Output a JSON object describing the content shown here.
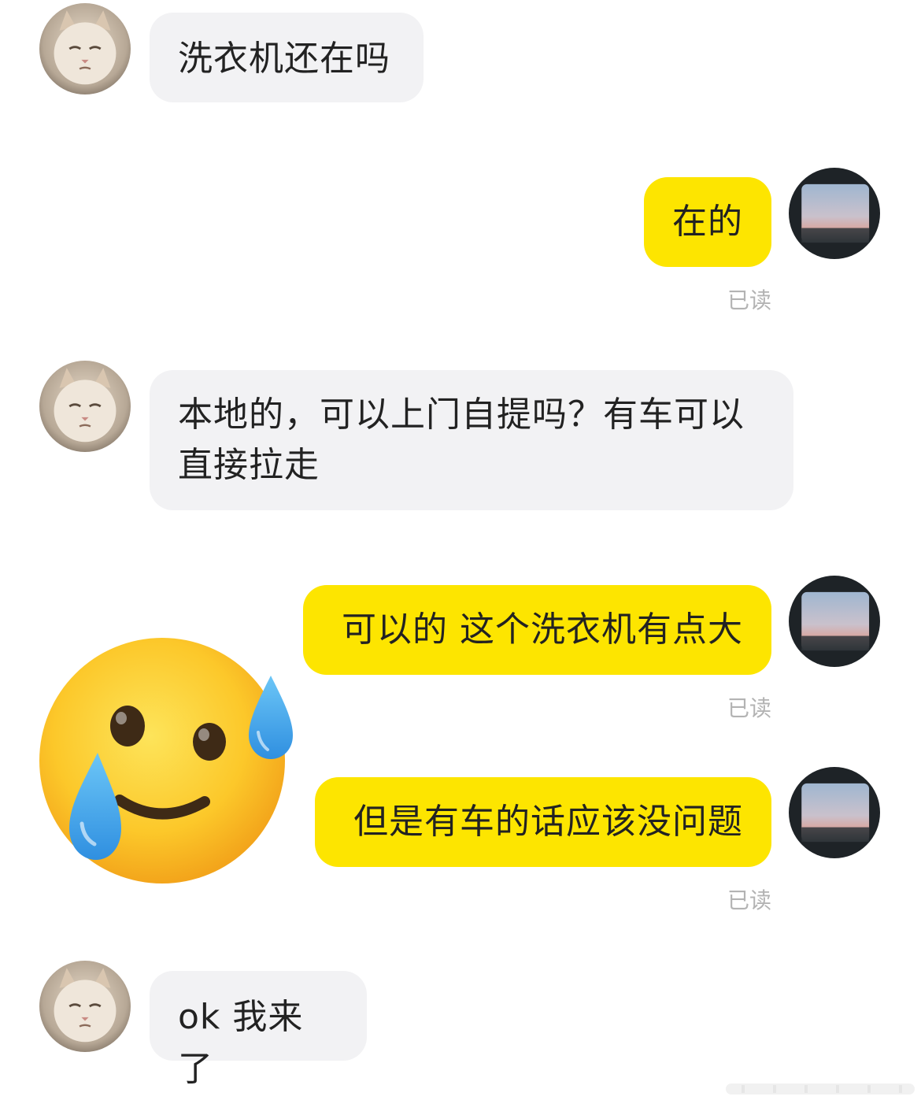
{
  "messages": [
    {
      "sender": "other",
      "text": "洗衣机还在吗"
    },
    {
      "sender": "me",
      "text": "在的",
      "status": "已读"
    },
    {
      "sender": "other",
      "text": "本地的，可以上门自提吗？有车可以直接拉走"
    },
    {
      "sender": "me",
      "text": "可以的 这个洗衣机有点大",
      "status": "已读"
    },
    {
      "sender": "me",
      "text": "但是有车的话应该没问题",
      "status": "已读"
    },
    {
      "sender": "other",
      "text": "ok 我来了"
    }
  ],
  "sticker": {
    "icon": "smiling-face-with-tear-emoji"
  },
  "avatars": {
    "other": {
      "icon": "cat-avatar-icon"
    },
    "me": {
      "icon": "window-sky-avatar-icon"
    }
  },
  "colors": {
    "outgoing_bubble": "#fde500",
    "incoming_bubble": "#f2f2f4",
    "read_status": "#b3b3b3"
  }
}
